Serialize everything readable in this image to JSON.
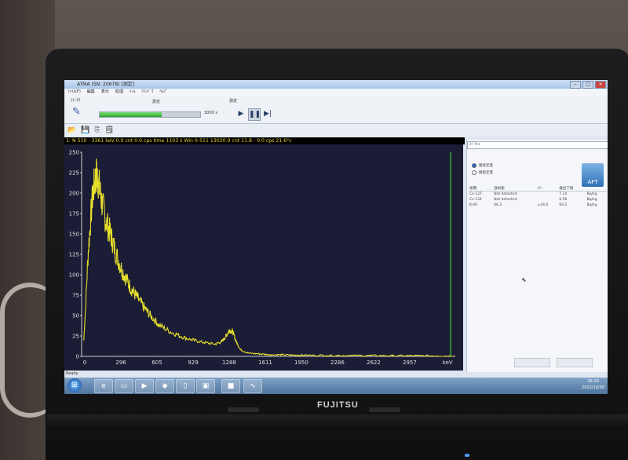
{
  "window": {
    "title": "ATMA (SN: 20678)  [測定]"
  },
  "menu": [
    "ﾌｧｲﾙ(F)",
    "編集",
    "表示",
    "処理",
    "ﾂｰﾙ",
    "ｳｲﾝﾄﾞｳ",
    "ﾍﾙﾌﾟ"
  ],
  "toolbar": {
    "left_label": "ｽﾃｰﾀｽ",
    "measure_label": "測定",
    "measure_label2": "測定",
    "progress_fraction": 0.62,
    "time_label": "3000 s"
  },
  "status_line": "1: N 510 - 3361 keV  0.0 cnt 0.0 cps   time 1103 s    Win 0-511 13020.0 cnt 11.8 - 0.0 cps   21.6°c",
  "chart_data": {
    "type": "line",
    "title": "",
    "xlabel": "keV",
    "ylabel": "",
    "x_ticks": [
      "0",
      "296",
      "605",
      "929",
      "1288",
      "1611",
      "1950",
      "2286",
      "2622",
      "2957"
    ],
    "y_ticks": [
      0,
      25,
      50,
      75,
      100,
      125,
      150,
      175,
      200,
      225,
      250
    ],
    "ylim": [
      0,
      250
    ],
    "xlim": [
      0,
      3361
    ],
    "grid": false,
    "series": [
      {
        "color": "#e6df2b",
        "x": [
          20,
          60,
          100,
          130,
          150,
          180,
          220,
          260,
          300,
          350,
          400,
          450,
          500,
          560,
          620,
          700,
          800,
          900,
          1000,
          1100,
          1200,
          1260,
          1300,
          1330,
          1360,
          1390,
          1430,
          1500,
          1600,
          1700,
          1800,
          1900,
          2000,
          2200,
          2400,
          2600,
          2800,
          3000,
          3200,
          3350
        ],
        "y": [
          20,
          130,
          200,
          222,
          215,
          190,
          165,
          150,
          130,
          110,
          95,
          82,
          72,
          60,
          50,
          38,
          30,
          24,
          20,
          17,
          15,
          18,
          25,
          32,
          30,
          18,
          8,
          4,
          3,
          2,
          2,
          1.5,
          1.5,
          1.2,
          1,
          1,
          0.8,
          0.8,
          0.6,
          0.5
        ]
      }
    ],
    "marker_line_x": 3361,
    "marker_line_color": "#33d12b"
  },
  "right_panel": {
    "dropdown": "ｽﾍﾟｸﾄﾙ",
    "radio1": "簡易定量",
    "radio2": "精密定量",
    "logo": "AFT",
    "columns": [
      "核種",
      "放射能",
      "ｴﾗｰ",
      "検出下限",
      ""
    ],
    "rows": [
      [
        "Cs-137",
        "Not detected",
        "",
        "7.14",
        "Bq/kg"
      ],
      [
        "Cs-134",
        "Not detected",
        "",
        "6.56",
        "Bq/kg"
      ],
      [
        "K-40",
        "66.3",
        "±34.6",
        "64.1",
        "Bq/kg"
      ]
    ]
  },
  "status_bar": "Ready",
  "tray": {
    "time": "16:29",
    "date": "2012/10/30"
  },
  "brand": "FUJITSU"
}
